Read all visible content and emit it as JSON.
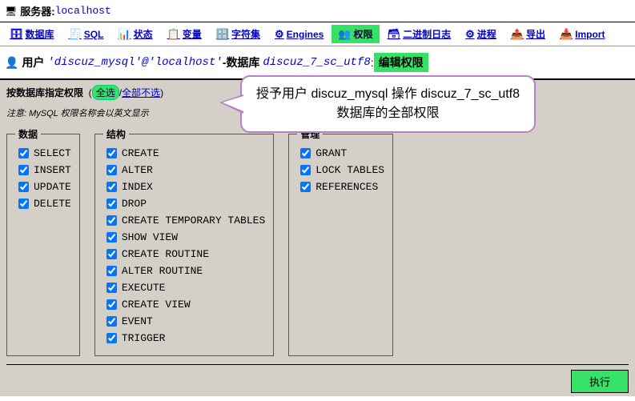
{
  "server_label": "服务器: ",
  "server_name": "localhost",
  "tabs": [
    {
      "icon": "db",
      "label": "数据库"
    },
    {
      "icon": "sql",
      "label": "SQL"
    },
    {
      "icon": "status",
      "label": "状态"
    },
    {
      "icon": "vars",
      "label": "变量"
    },
    {
      "icon": "charset",
      "label": "字符集"
    },
    {
      "icon": "engines",
      "label": "Engines"
    },
    {
      "icon": "priv",
      "label": "权限"
    },
    {
      "icon": "binlog",
      "label": "二进制日志"
    },
    {
      "icon": "proc",
      "label": "进程"
    },
    {
      "icon": "export",
      "label": "导出"
    },
    {
      "icon": "import",
      "label": "Import"
    }
  ],
  "title": {
    "user_label": "用户",
    "user": "'discuz_mysql'@'localhost'",
    "dash": " - ",
    "db_label": "数据库",
    "db": "discuz_7_sc_utf8",
    "colon": " : ",
    "edit_priv": "编辑权限"
  },
  "spec": {
    "legend": "按数据库指定权限",
    "select_all": "全选",
    "slash": " / ",
    "unselect_all": "全部不选",
    "close": ")"
  },
  "note": "注意: MySQL 权限名称会以英文显示",
  "groups": {
    "data": {
      "legend": "数据",
      "items": [
        "SELECT",
        "INSERT",
        "UPDATE",
        "DELETE"
      ]
    },
    "structure": {
      "legend": "结构",
      "items": [
        "CREATE",
        "ALTER",
        "INDEX",
        "DROP",
        "CREATE TEMPORARY TABLES",
        "SHOW VIEW",
        "CREATE ROUTINE",
        "ALTER ROUTINE",
        "EXECUTE",
        "CREATE VIEW",
        "EVENT",
        "TRIGGER"
      ]
    },
    "admin": {
      "legend": "管理",
      "items": [
        "GRANT",
        "LOCK TABLES",
        "REFERENCES"
      ]
    }
  },
  "callout": {
    "line1_a": "授予用户 ",
    "line1_b": "discuz_mysql",
    "line1_c": " 操作 ",
    "line1_d": "discuz_7_sc_utf8",
    "line2": "数据库的全部权限"
  },
  "go": "执行"
}
